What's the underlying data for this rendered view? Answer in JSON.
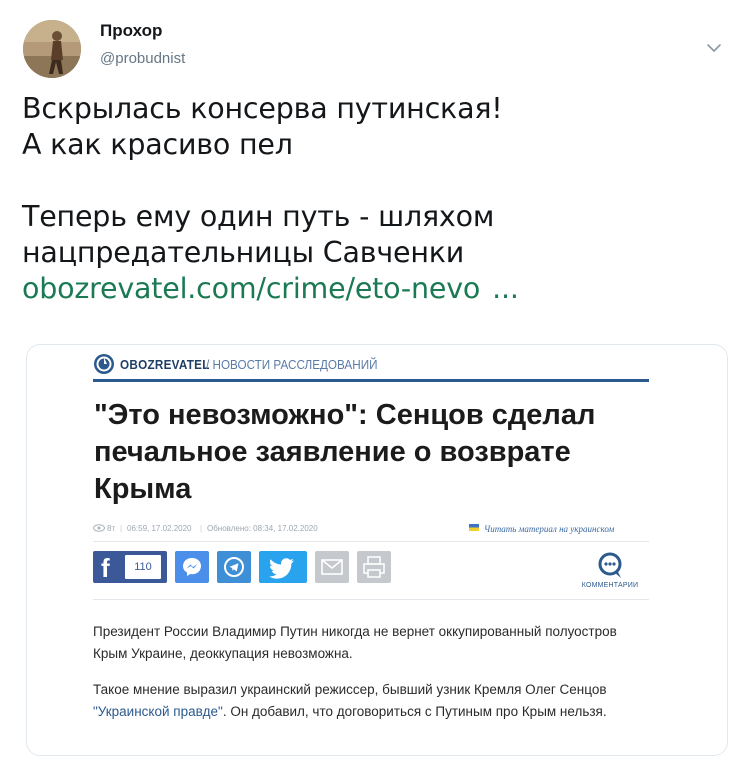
{
  "author": {
    "name": "Прохор",
    "handle": "@probudnist"
  },
  "tweet": {
    "line1": "Вскрылась консерва путинская!",
    "line2": "А как красиво пел",
    "line3": "Теперь ему один путь - шляхом",
    "line4": "нацпредательницы Савченки",
    "link": "obozrevatel.com/crime/eto-nevo",
    "ellipsis": "..."
  },
  "card": {
    "site_name": "OBOZREVATEL",
    "section": "/ НОВОСТИ РАССЛЕДОВАНИЙ",
    "headline": "\"Это невозможно\": Сенцов сделал печальное заявление о возврате Крыма",
    "meta": {
      "views": "8т",
      "published": "06:59, 17.02.2020",
      "updated": "Обновлено: 08:34, 17.02.2020",
      "read_ua": "Читать материал на украинском"
    },
    "share": {
      "fb_count": "110"
    },
    "comments_label": "КОММЕНТАРИИ",
    "paragraph1": "Президент России Владимир Путин никогда не вернет оккупированный полуостров Крым Украине, деоккупация невозможна.",
    "paragraph2_start": "Такое мнение выразил украинский режиссер, бывший узник Кремля Олег Сенцов ",
    "paragraph2_link": "\"Украинской правде\"",
    "paragraph2_end": ". Он добавил, что договориться с Путиным про Крым нельзя."
  },
  "colors": {
    "link_green": "#1b7a53",
    "brand_blue": "#2c5a8e",
    "facebook": "#3b5998",
    "twitter": "#2aa3ef"
  },
  "icons": [
    "chevron-down-icon",
    "obozrevatel-logo-icon",
    "eye-icon",
    "ukraine-flag-icon",
    "facebook-icon",
    "messenger-icon",
    "telegram-icon",
    "twitter-icon",
    "mail-icon",
    "print-icon",
    "comments-icon"
  ]
}
